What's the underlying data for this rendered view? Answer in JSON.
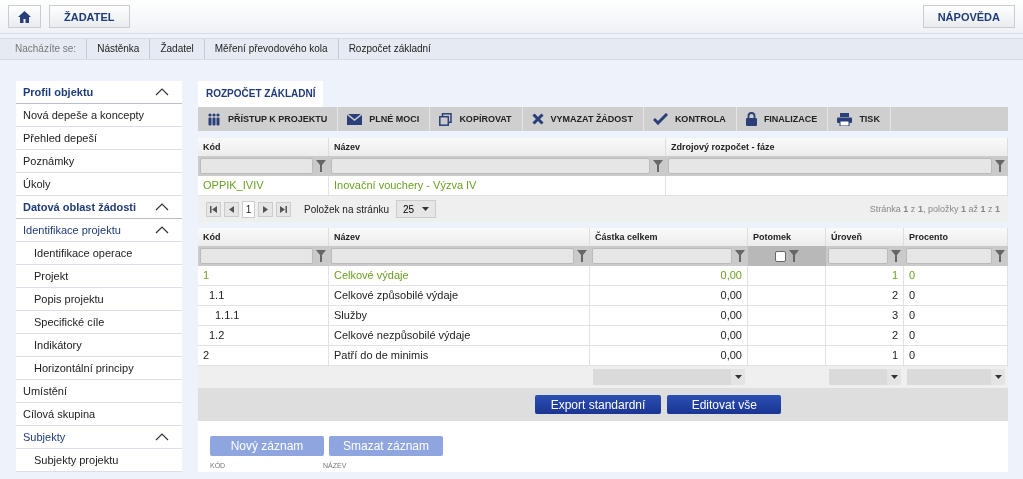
{
  "top_bar": {
    "buttons": [
      "ŽADATEL"
    ],
    "help_button": "NÁPOVĚDA"
  },
  "breadcrumb": {
    "prefix": "Nacházíte se:",
    "items": [
      "Nástěnka",
      "Žadatel",
      "Měření převodového kola",
      "Rozpočet základní"
    ]
  },
  "sidebar": [
    {
      "title": "Profil objektu",
      "expanded": true,
      "items": [
        {
          "label": "Nová depeše a koncepty"
        },
        {
          "label": "Přehled depeší"
        },
        {
          "label": "Poznámky"
        },
        {
          "label": "Úkoly"
        }
      ]
    },
    {
      "title": "Datová oblast žádosti",
      "expanded": true,
      "items": [
        {
          "label": "Identifikace projektu",
          "expanded": true,
          "children": [
            {
              "label": "Identifikace operace"
            },
            {
              "label": "Projekt"
            },
            {
              "label": "Popis projektu"
            },
            {
              "label": "Specifické cíle"
            },
            {
              "label": "Indikátory"
            },
            {
              "label": "Horizontální principy"
            }
          ]
        },
        {
          "label": "Umístění"
        },
        {
          "label": "Cílová skupina"
        },
        {
          "label": "Subjekty",
          "expanded": true,
          "children": [
            {
              "label": "Subjekty projektu"
            }
          ]
        }
      ]
    }
  ],
  "tabs": [
    {
      "label": "ROZPOČET ZÁKLADNÍ",
      "selected": true
    }
  ],
  "toolbar": [
    {
      "label": "PŘÍSTUP K PROJEKTU",
      "kind": "people"
    },
    {
      "label": "PLNÉ MOCI",
      "kind": "mail"
    },
    {
      "label": "KOPÍROVAT",
      "kind": "copy"
    },
    {
      "label": "VYMAZAT ŽÁDOST",
      "kind": "delete"
    },
    {
      "label": "KONTROLA",
      "kind": "check"
    },
    {
      "label": "FINALIZACE",
      "kind": "lock"
    },
    {
      "label": "TISK",
      "kind": "print"
    }
  ],
  "project_grid": {
    "columns": [
      "Kód",
      "Název",
      "Zdrojový rozpočet - fáze"
    ],
    "rows": [
      {
        "cells": [
          "OPPIK_IVIV",
          "Inovační vouchery - Výzva IV"
        ],
        "selected": true
      }
    ]
  },
  "pager": {
    "page": "1",
    "page_size_label": "Položek na stránku",
    "page_size": "25",
    "summary": "Stránka **1** z **1**, položky **1** až **1** z **1**"
  },
  "budget_grid": {
    "columns": [
      {
        "label": "Kód",
        "kind": "text",
        "aggregate": false
      },
      {
        "label": "Název",
        "kind": "text",
        "aggregate": false
      },
      {
        "label": "Částka celkem",
        "kind": "text",
        "aggregate": true
      },
      {
        "label": "Potomek",
        "kind": "checkbox",
        "checked": false,
        "aggregate": false
      },
      {
        "label": "Úroveň",
        "kind": "text",
        "aggregate": true
      },
      {
        "label": "Procento",
        "kind": "text",
        "aggregate": true
      }
    ],
    "rows": [
      {
        "kod": "1",
        "nazev": "Celkové výdaje",
        "castka": "0,00",
        "uroven": "1",
        "procento": "0",
        "selected": true,
        "children": [
          {
            "kod": "1.1",
            "nazev": "Celkové způsobilé výdaje",
            "castka": "0,00",
            "uroven": "2",
            "procento": "0",
            "selected": false,
            "children": [
              {
                "kod": "1.1.1",
                "nazev": "Služby",
                "castka": "0,00",
                "uroven": "3",
                "procento": "0",
                "selected": false
              }
            ]
          },
          {
            "kod": "1.2",
            "nazev": "Celkové nezpůsobilé výdaje",
            "castka": "0,00",
            "uroven": "2",
            "procento": "0",
            "selected": false
          }
        ]
      },
      {
        "kod": "2",
        "nazev": "Patří do de minimis",
        "castka": "0,00",
        "uroven": "1",
        "procento": "0",
        "selected": false
      }
    ]
  },
  "actions": [
    "Export standardní",
    "Editovat vše"
  ],
  "record_buttons": [
    {
      "label": "Nový záznam",
      "disabled": true
    },
    {
      "label": "Smazat záznam",
      "disabled": true
    }
  ],
  "record_columns": [
    "KÓD",
    "NÁZEV"
  ]
}
